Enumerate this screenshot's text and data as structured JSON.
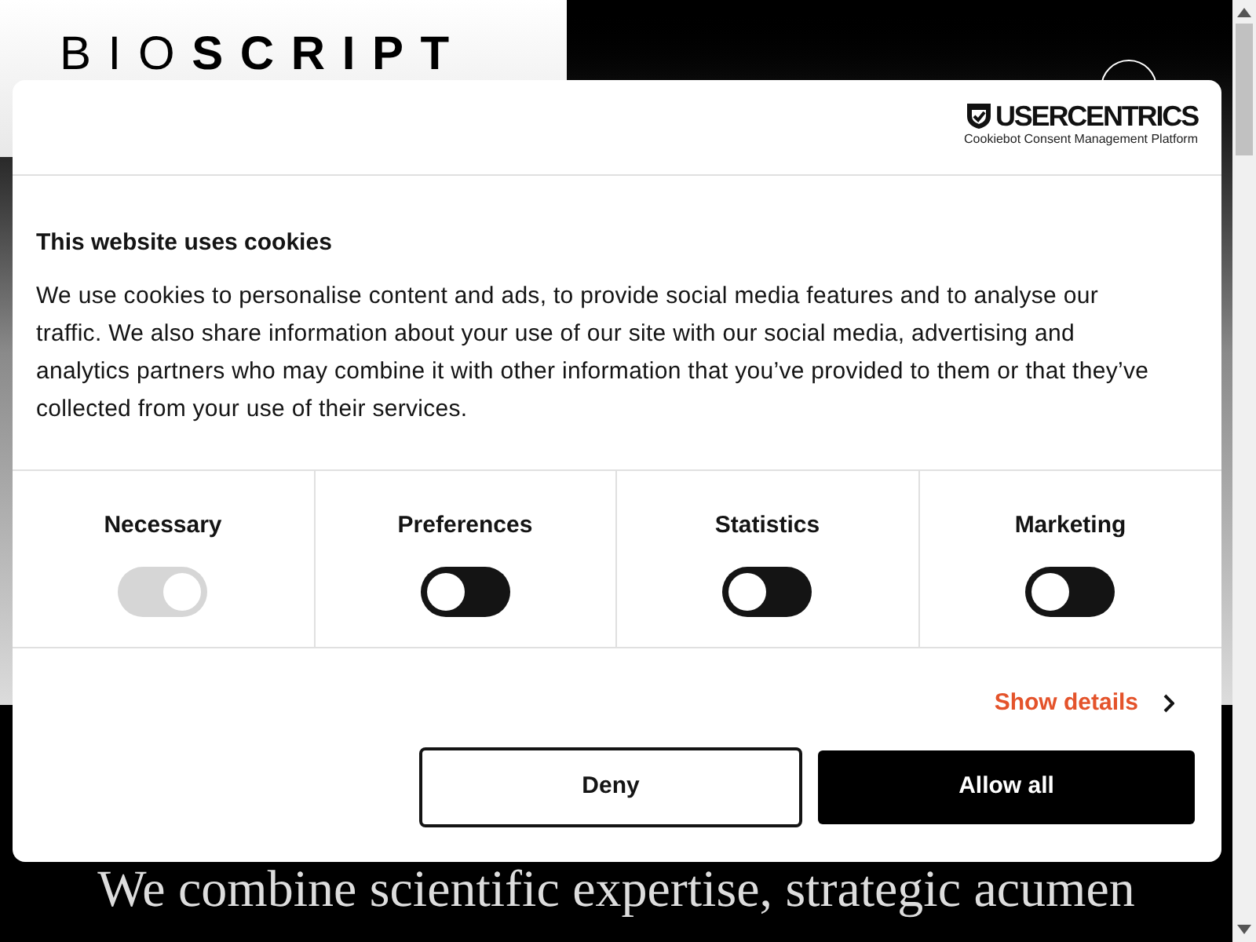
{
  "site": {
    "logo_light": "BIO",
    "logo_bold": "SCRIPT",
    "headline": "We combine scientific expertise, strategic acumen"
  },
  "dialog": {
    "brand": "USERCENTRICS",
    "brand_tagline": "Cookiebot Consent Management Platform",
    "title": "This website uses cookies",
    "body": "We use cookies to personalise content and ads, to provide social media features and to analyse our traffic. We also share information about your use of our site with our social media, advertising and analytics partners who may combine it with other information that you’ve provided to them or that they’ve collected from your use of their services.",
    "categories": [
      {
        "label": "Necessary",
        "checked": true,
        "disabled": true
      },
      {
        "label": "Preferences",
        "checked": false,
        "disabled": false
      },
      {
        "label": "Statistics",
        "checked": false,
        "disabled": false
      },
      {
        "label": "Marketing",
        "checked": false,
        "disabled": false
      }
    ],
    "details_link": "Show details",
    "buttons": [
      {
        "label": "Deny",
        "kind": "outline"
      },
      {
        "label": "Allow all",
        "kind": "solid"
      }
    ]
  }
}
